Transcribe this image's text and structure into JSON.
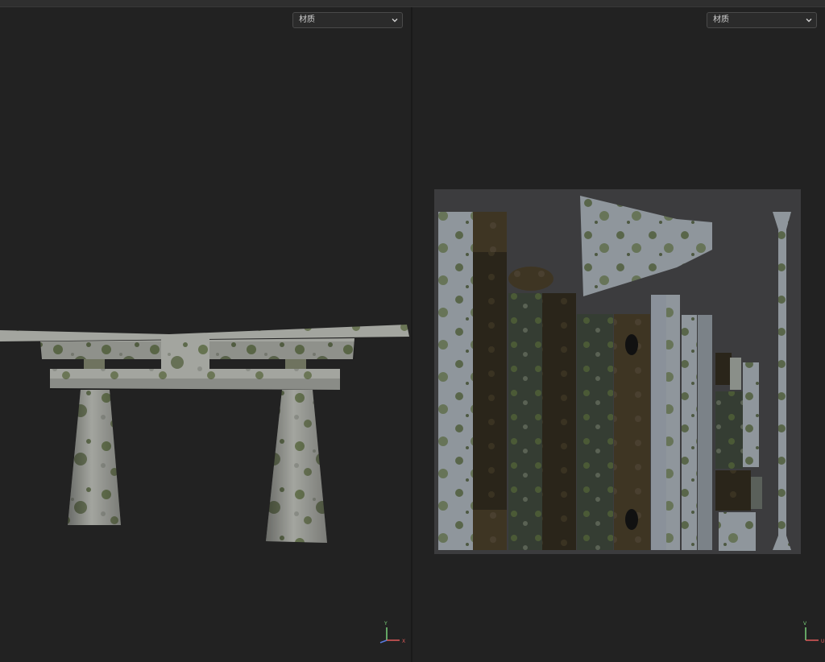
{
  "left_viewport": {
    "mode_dropdown": {
      "value": "材质"
    },
    "axis_labels": {
      "y": "Y",
      "x": "X"
    }
  },
  "right_viewport": {
    "mode_dropdown": {
      "value": "材质"
    },
    "axis_labels": {
      "v": "V",
      "u": "U"
    }
  },
  "colors": {
    "background": "#222222",
    "stone": "#9a9c96",
    "moss": "#4b5a36",
    "uv_canvas": "#3c3c3e"
  },
  "icons": [
    "chevron-down-icon",
    "axis-gizmo-icon"
  ]
}
